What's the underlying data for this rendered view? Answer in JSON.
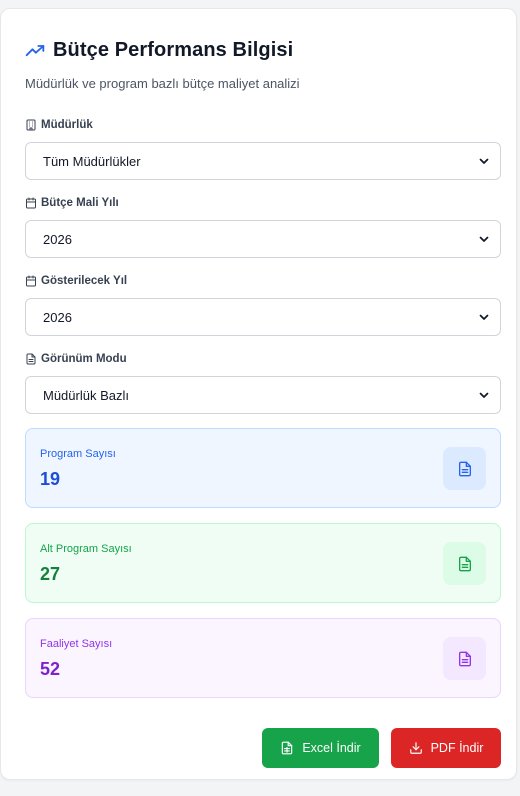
{
  "header": {
    "title": "Bütçe Performans Bilgisi",
    "subtitle": "Müdürlük ve program bazlı bütçe maliyet analizi",
    "title_icon": "trending-up-icon",
    "accent_color": "#2563eb"
  },
  "filters": {
    "mudurluk": {
      "label": "Müdürlük",
      "icon": "building-icon",
      "value": "Tüm Müdürlükler"
    },
    "butce_mali_yili": {
      "label": "Bütçe Mali Yılı",
      "icon": "calendar-icon",
      "value": "2026"
    },
    "gosterilecek_yil": {
      "label": "Gösterilecek Yıl",
      "icon": "calendar-icon",
      "value": "2026"
    },
    "gorunum_modu": {
      "label": "Görünüm Modu",
      "icon": "document-icon",
      "value": "Müdürlük Bazlı"
    }
  },
  "stats": [
    {
      "label": "Program Sayısı",
      "value": "19",
      "icon": "document-icon",
      "color": "#1d4ed8",
      "label_color": "#2563eb",
      "bg": "#eff6ff",
      "border": "#bfdbfe",
      "icon_bg": "#dbeafe"
    },
    {
      "label": "Alt Program Sayısı",
      "value": "27",
      "icon": "document-icon",
      "color": "#15803d",
      "label_color": "#16a34a",
      "bg": "#f0fdf4",
      "border": "#bbf7d0",
      "icon_bg": "#dcfce7"
    },
    {
      "label": "Faaliyet Sayısı",
      "value": "52",
      "icon": "document-icon",
      "color": "#7e22ce",
      "label_color": "#9333ea",
      "bg": "#faf5ff",
      "border": "#e9d5ff",
      "icon_bg": "#f3e8ff"
    }
  ],
  "actions": {
    "excel": {
      "label": "Excel İndir",
      "icon": "spreadsheet-icon",
      "color": "#16a34a"
    },
    "pdf": {
      "label": "PDF İndir",
      "icon": "download-icon",
      "color": "#dc2626"
    }
  }
}
